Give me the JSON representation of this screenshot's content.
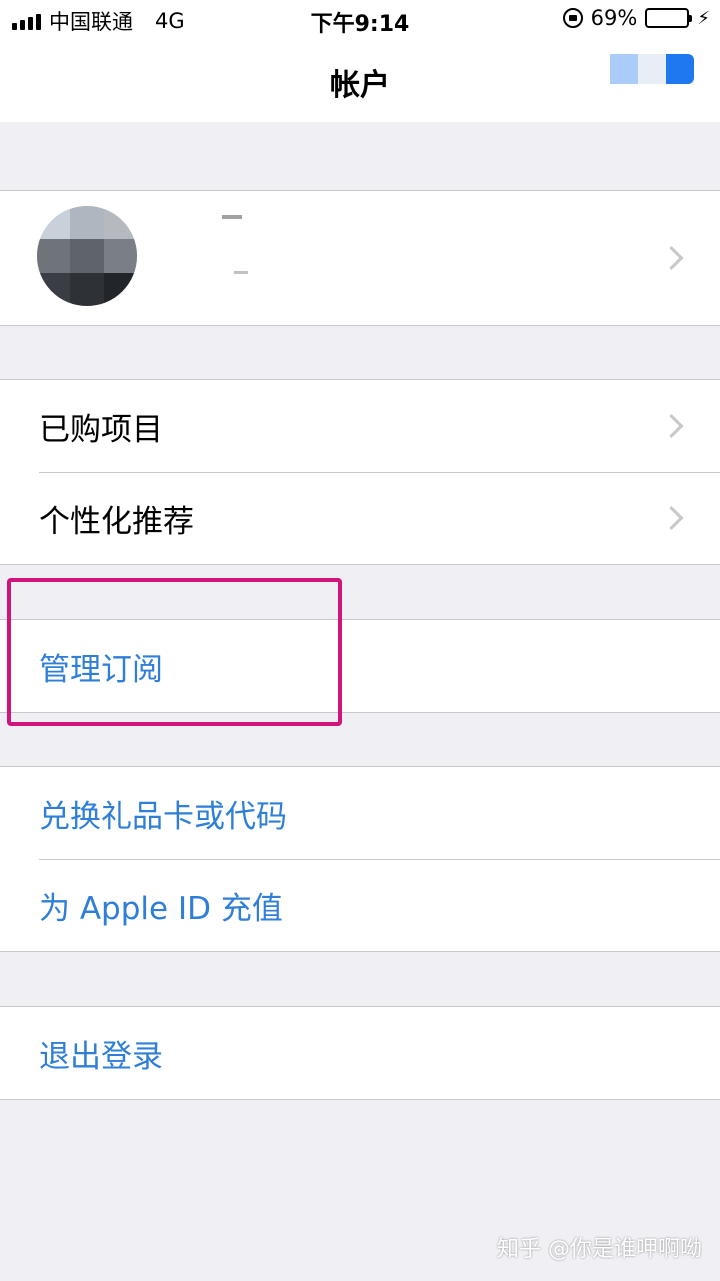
{
  "status_bar": {
    "carrier": "中国联通",
    "network": "4G",
    "time": "下午9:14",
    "battery_percent": "69%",
    "battery_level": 0.69
  },
  "nav": {
    "title": "帐户"
  },
  "profile": {
    "chevron_icon": "chevron-right-icon"
  },
  "group1": [
    {
      "label": "已购项目"
    },
    {
      "label": "个性化推荐"
    }
  ],
  "group2": [
    {
      "label": "管理订阅"
    }
  ],
  "group3": [
    {
      "label": "兑换礼品卡或代码"
    },
    {
      "label": "为 Apple ID 充值"
    }
  ],
  "group4": [
    {
      "label": "退出登录"
    }
  ],
  "watermark": "知乎 @你是谁呷啊呦",
  "colors": {
    "link": "#2f7fd8",
    "highlight": "#d0157a",
    "background": "#efeff4"
  }
}
